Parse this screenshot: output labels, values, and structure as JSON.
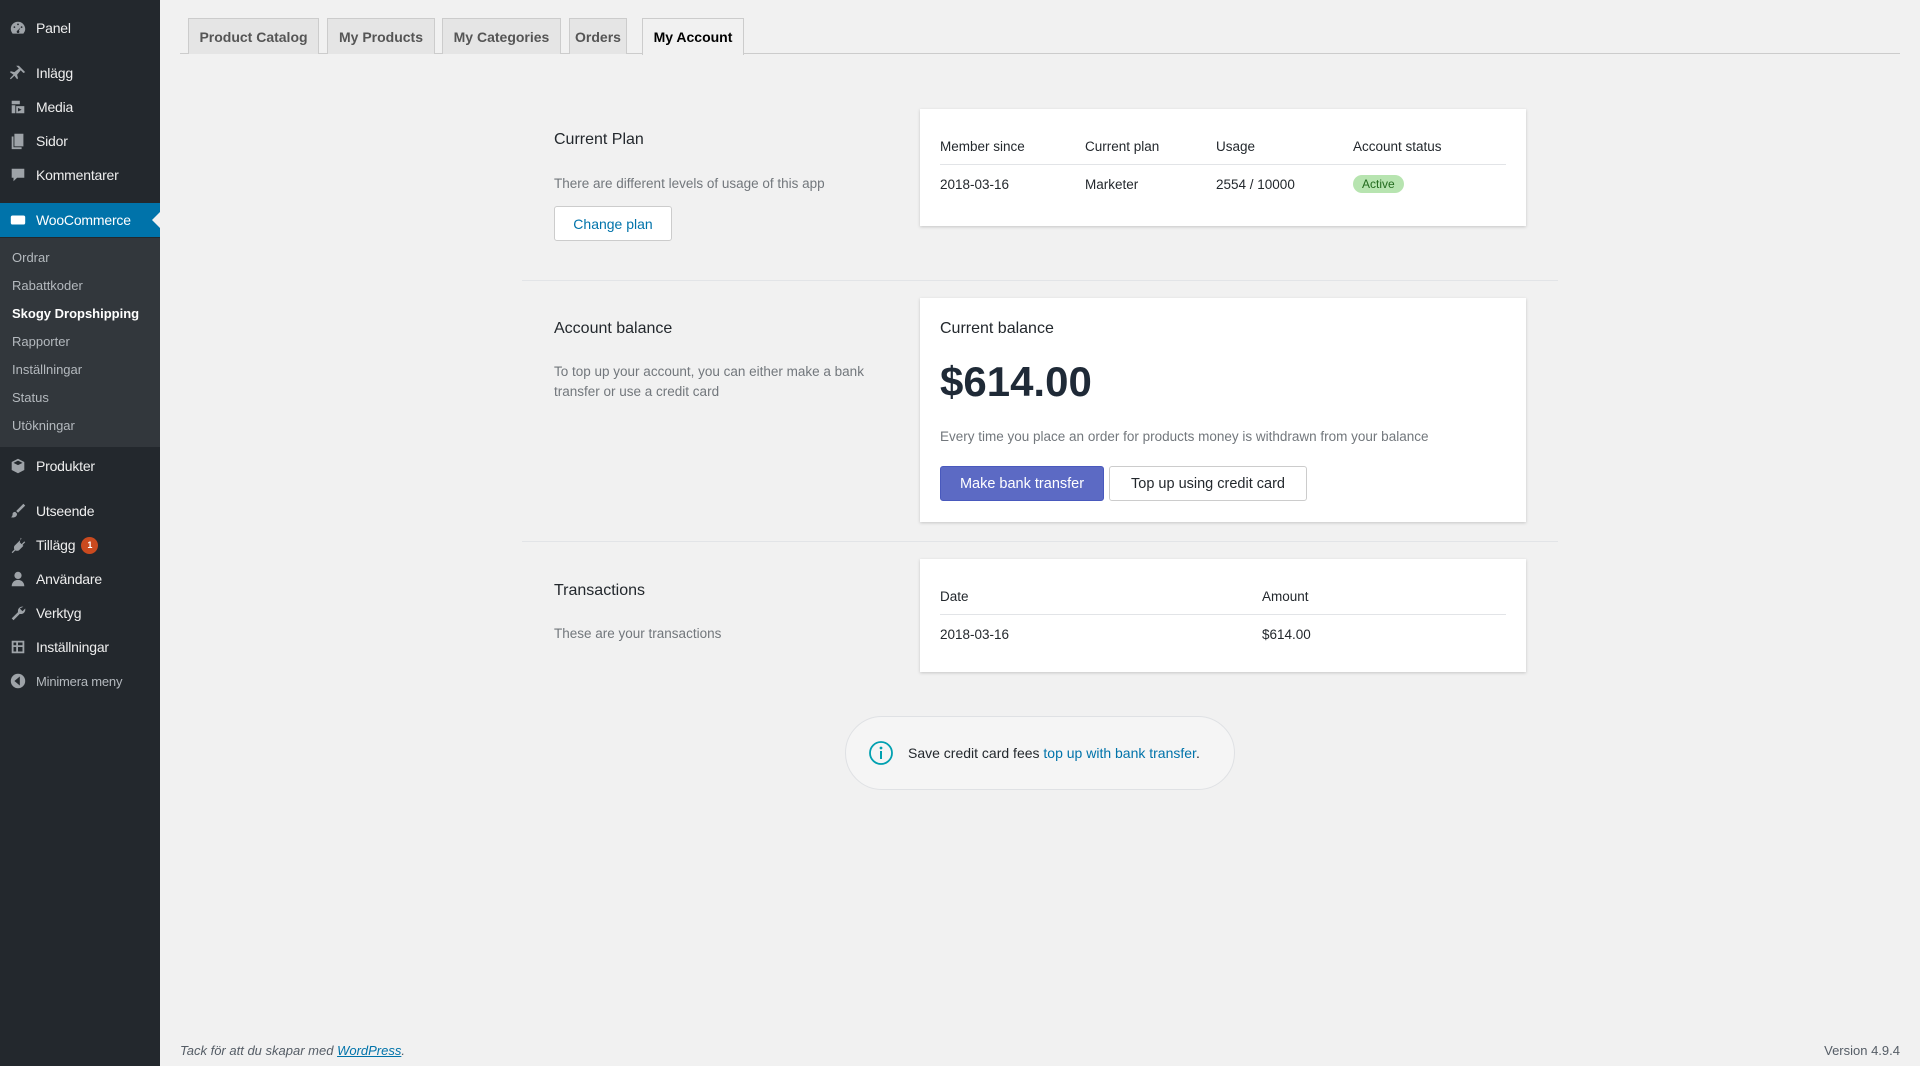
{
  "sidebar": {
    "items": [
      {
        "label": "Panel",
        "icon": "dashboard-icon"
      },
      {
        "label": "Inlägg",
        "icon": "pin-icon"
      },
      {
        "label": "Media",
        "icon": "media-icon"
      },
      {
        "label": "Sidor",
        "icon": "pages-icon"
      },
      {
        "label": "Kommentarer",
        "icon": "comment-icon"
      },
      {
        "label": "WooCommerce",
        "icon": "woo-icon"
      },
      {
        "label": "Produkter",
        "icon": "box-icon"
      },
      {
        "label": "Utseende",
        "icon": "brush-icon"
      },
      {
        "label": "Tillägg",
        "icon": "plugin-icon",
        "badge": "1"
      },
      {
        "label": "Användare",
        "icon": "user-icon"
      },
      {
        "label": "Verktyg",
        "icon": "wrench-icon"
      },
      {
        "label": "Inställningar",
        "icon": "settings-icon"
      },
      {
        "label": "Minimera meny",
        "icon": "collapse-icon"
      }
    ],
    "submenu": [
      "Ordrar",
      "Rabattkoder",
      "Skogy Dropshipping",
      "Rapporter",
      "Inställningar",
      "Status",
      "Utökningar"
    ],
    "active_submenu": "Skogy Dropshipping",
    "accent_color": "#0073aa"
  },
  "tabs": [
    "Product Catalog",
    "My Products",
    "My Categories",
    "Orders",
    "My Account"
  ],
  "active_tab": "My Account",
  "plan": {
    "title": "Current Plan",
    "description": "There are different levels of usage of this app",
    "button": "Change plan",
    "headers": [
      "Member since",
      "Current plan",
      "Usage",
      "Account status"
    ],
    "row": [
      "2018-03-16",
      "Marketer",
      "2554 / 10000",
      "Active"
    ]
  },
  "balance": {
    "title": "Account balance",
    "description": "To top up your account, you can either make a bank transfer or use a credit card",
    "card_title": "Current balance",
    "amount": "$614.00",
    "note": "Every time you place an order for products money is withdrawn from your balance",
    "bank_button": "Make bank transfer",
    "card_button": "Top up using credit card",
    "primary_color": "#5c6ac4"
  },
  "transactions": {
    "title": "Transactions",
    "description": "These are your transactions",
    "headers": [
      "Date",
      "Amount"
    ],
    "rows": [
      [
        "2018-03-16",
        "$614.00"
      ]
    ]
  },
  "notice": {
    "text": "Save credit card fees",
    "link": "top up with bank transfer",
    "suffix": "."
  },
  "footer": {
    "thanks": "Tack för att du skapar med",
    "link": "WordPress",
    "suffix": ".",
    "version": "Version 4.9.4"
  }
}
